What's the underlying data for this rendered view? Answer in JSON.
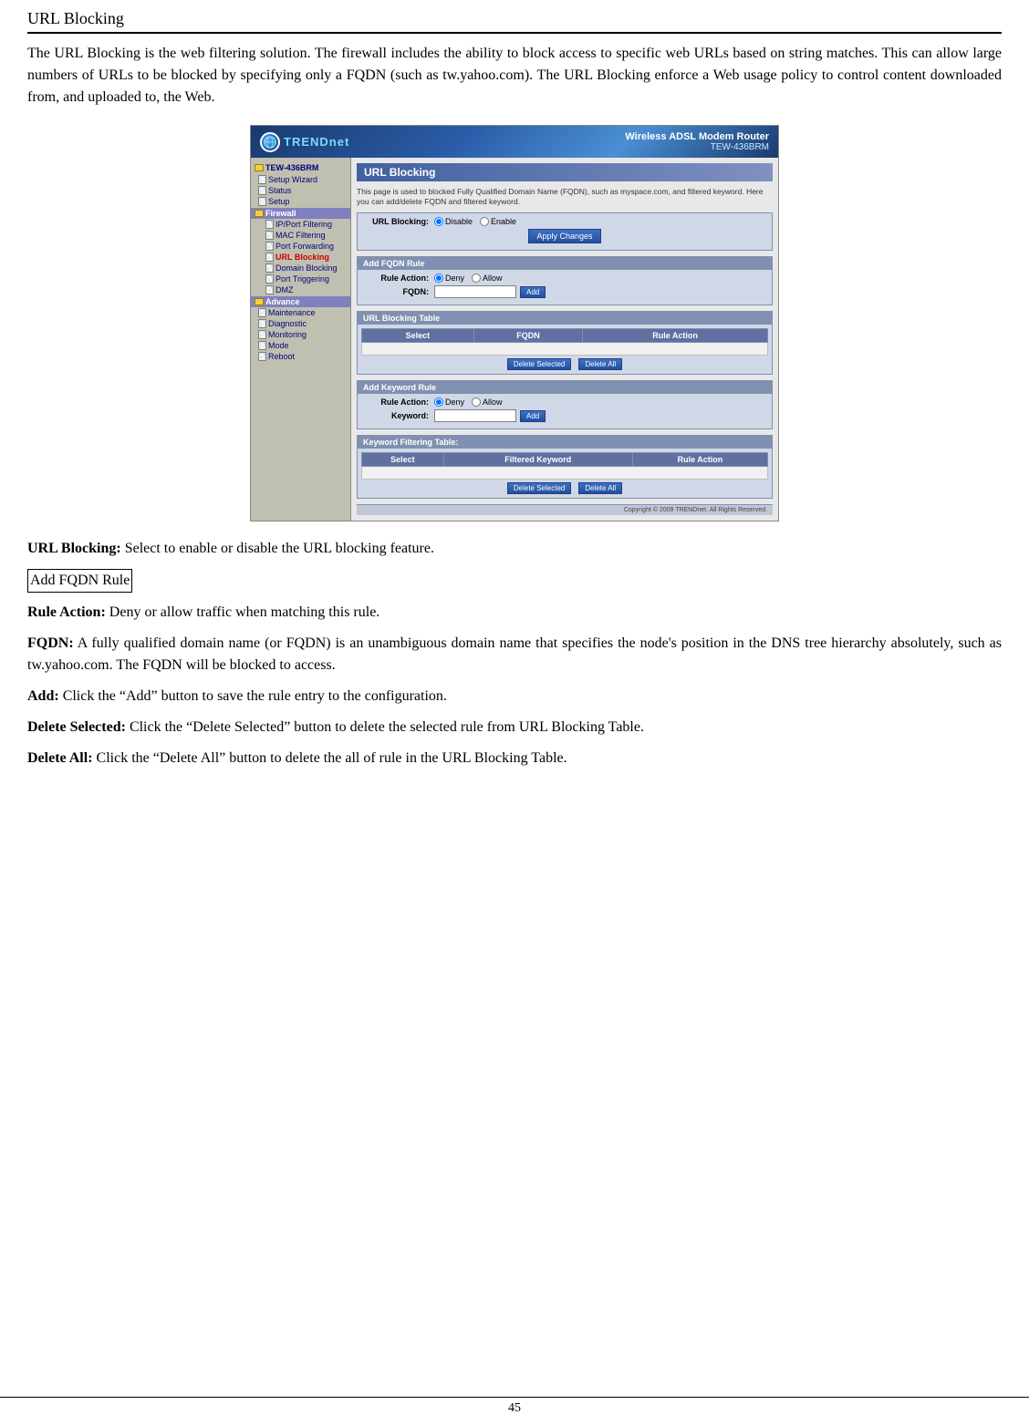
{
  "page": {
    "title": "URL Blocking",
    "page_number": "45"
  },
  "intro": {
    "text": "The URL Blocking is the web filtering solution. The firewall includes the ability to block access to specific web URLs based on string matches. This can allow large numbers of URLs to be blocked by specifying only a FQDN (such as tw.yahoo.com). The URL Blocking enforce a Web usage policy to control content downloaded from, and uploaded to, the Web."
  },
  "router_ui": {
    "header": {
      "logo_text": "TRENDnet",
      "logo_text_colored": "TREND",
      "logo_text_rest": "net",
      "wireless_title": "Wireless ADSL Modem Router",
      "model": "TEW-436BRM"
    },
    "nav": {
      "device": "TEW-436BRM",
      "items": [
        {
          "label": "Setup Wizard",
          "type": "file",
          "indent": 1
        },
        {
          "label": "Status",
          "type": "file",
          "indent": 1
        },
        {
          "label": "Setup",
          "type": "file",
          "indent": 1
        },
        {
          "label": "Firewall",
          "type": "section",
          "indent": 0
        },
        {
          "label": "IP/Port Filtering",
          "type": "file",
          "indent": 2
        },
        {
          "label": "MAC Filtering",
          "type": "file",
          "indent": 2
        },
        {
          "label": "Port Forwarding",
          "type": "file",
          "indent": 2
        },
        {
          "label": "URL Blocking",
          "type": "file",
          "indent": 2,
          "active": true
        },
        {
          "label": "Domain Blocking",
          "type": "file",
          "indent": 2
        },
        {
          "label": "Port Triggering",
          "type": "file",
          "indent": 2
        },
        {
          "label": "DMZ",
          "type": "file",
          "indent": 2
        },
        {
          "label": "Advance",
          "type": "section",
          "indent": 0
        },
        {
          "label": "Maintenance",
          "type": "file",
          "indent": 1
        },
        {
          "label": "Diagnostic",
          "type": "file",
          "indent": 1
        },
        {
          "label": "Monitoring",
          "type": "file",
          "indent": 1
        },
        {
          "label": "Mode",
          "type": "file",
          "indent": 1
        },
        {
          "label": "Reboot",
          "type": "file",
          "indent": 1
        }
      ]
    },
    "content": {
      "title": "URL Blocking",
      "description": "This page is used to blocked Fully Qualified Domain Name (FQDN), such as myspace.com, and filtered keyword. Here you can add/delete FQDN and filtered keyword.",
      "url_blocking_label": "URL Blocking:",
      "disable_label": "Disable",
      "enable_label": "Enable",
      "apply_changes_btn": "Apply Changes",
      "add_fqdn_section": "Add FQDN Rule",
      "rule_action_label": "Rule Action:",
      "deny_label": "Deny",
      "allow_label": "Allow",
      "fqdn_label": "FQDN:",
      "add_btn": "Add",
      "url_blocking_table_title": "URL Blocking Table",
      "table_cols": [
        "Select",
        "FQDN",
        "Rule Action"
      ],
      "delete_selected_btn": "Delete Selected",
      "delete_all_btn": "Delete All",
      "add_keyword_section": "Add Keyword Rule",
      "keyword_rule_action_label": "Rule Action:",
      "keyword_deny_label": "Deny",
      "keyword_allow_label": "Allow",
      "keyword_label": "Keyword:",
      "keyword_add_btn": "Add",
      "keyword_table_title": "Keyword Filtering Table:",
      "keyword_table_cols": [
        "Select",
        "Filtered Keyword",
        "Rule Action"
      ],
      "keyword_delete_selected_btn": "Delete Selected",
      "keyword_delete_all_btn": "Delete All",
      "copyright": "Copyright © 2009 TRENDnet. All Rights Reserved."
    }
  },
  "descriptions": [
    {
      "id": "url-blocking-desc",
      "bold": "URL Blocking:",
      "text": " Select to enable or disable the URL blocking feature."
    },
    {
      "id": "add-fqdn-rule-header",
      "boxed": "Add FQDN Rule"
    },
    {
      "id": "rule-action-desc",
      "bold": "Rule Action:",
      "text": " Deny or allow traffic when matching this rule."
    },
    {
      "id": "fqdn-desc",
      "bold": "FQDN:",
      "text": " A fully qualified domain name (or FQDN) is an unambiguous domain name that specifies the node's position in the DNS tree hierarchy absolutely, such as tw.yahoo.com. The FQDN will be blocked to access."
    },
    {
      "id": "add-desc",
      "bold": "Add:",
      "text": " Click the “Add” button to save the rule entry to the configuration."
    },
    {
      "id": "delete-selected-desc",
      "bold": "Delete Selected:",
      "text": " Click the “Delete Selected” button to delete the selected rule from URL Blocking Table."
    },
    {
      "id": "delete-all-desc",
      "bold": "Delete All:",
      "text": " Click the “Delete All” button to delete the all of rule in the URL Blocking Table."
    }
  ]
}
